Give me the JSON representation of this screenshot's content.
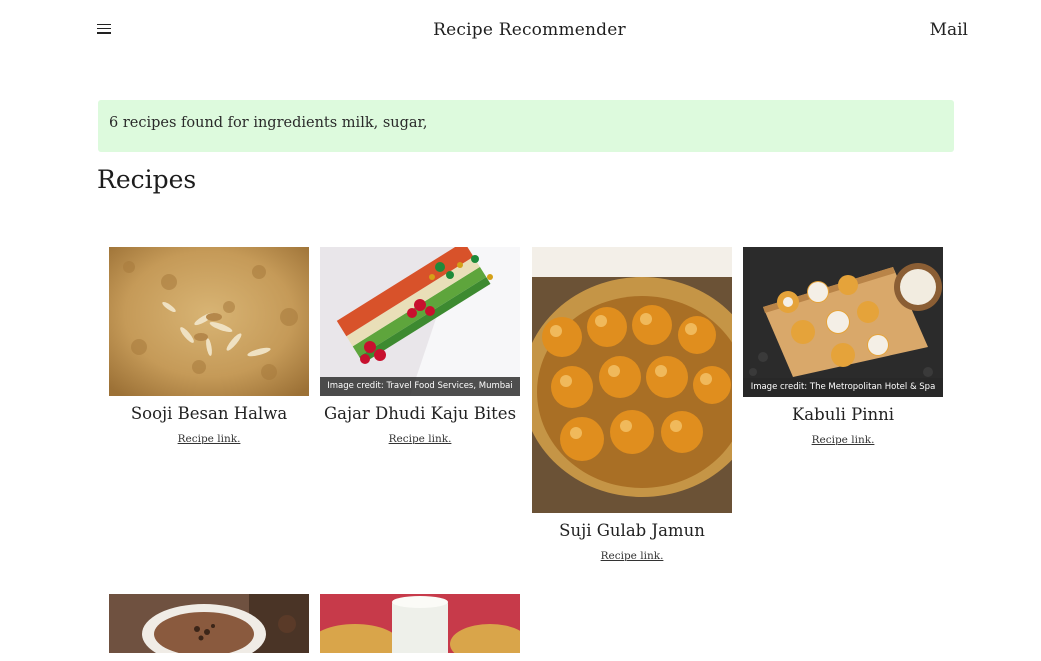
{
  "header": {
    "menu_icon": "hamburger-icon",
    "title": "Recipe Recommender",
    "mail_label": "Mail"
  },
  "alert": {
    "message": "6 recipes found for ingredients milk, sugar,",
    "color": "#ddfadd"
  },
  "section_title": "Recipes",
  "recipes": [
    {
      "name": "Sooji Besan Halwa",
      "link_label": "Recipe link."
    },
    {
      "name": "Gajar Dhudi Kaju Bites",
      "link_label": "Recipe link.",
      "credit": "Image credit: Travel Food Services, Mumbai"
    },
    {
      "name": "Suji Gulab Jamun",
      "link_label": "Recipe link."
    },
    {
      "name": "Kabuli Pinni",
      "link_label": "Recipe link.",
      "credit": "Image credit: The Metropolitan Hotel & Spa"
    },
    {
      "name": "",
      "link_label": ""
    },
    {
      "name": "",
      "link_label": ""
    }
  ]
}
